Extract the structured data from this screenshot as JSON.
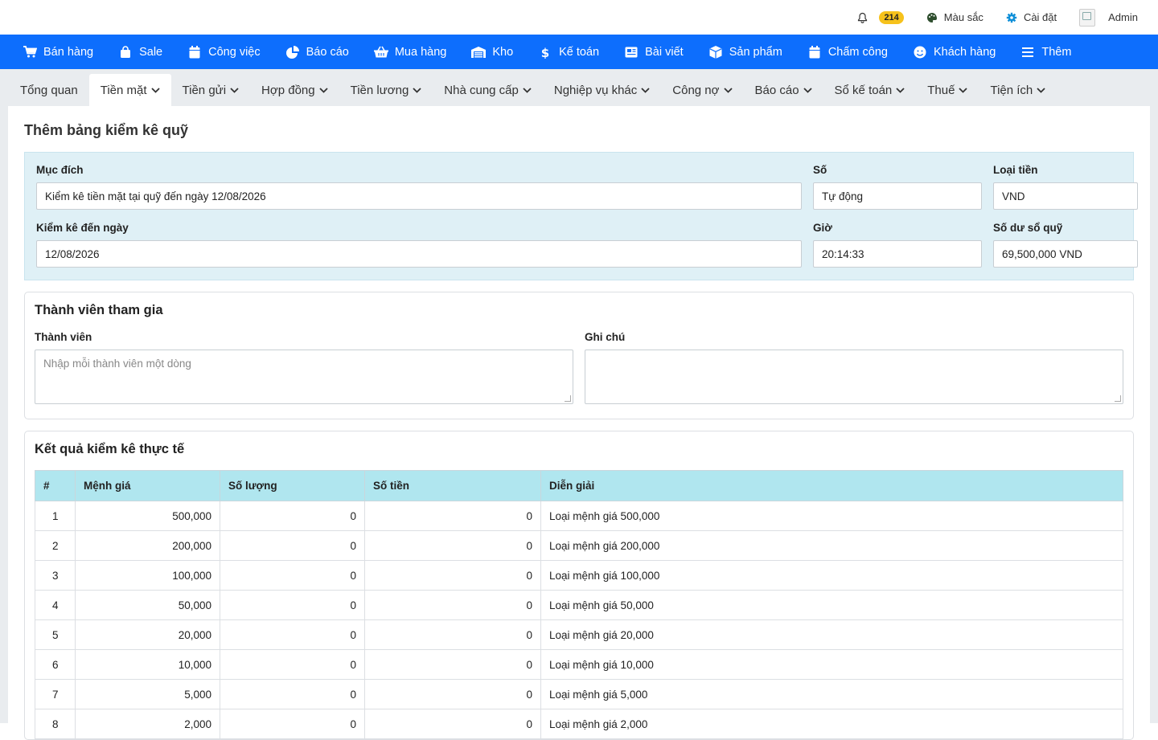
{
  "topbar": {
    "notification_count": "214",
    "color_label": "Màu sắc",
    "settings_label": "Cài đặt",
    "user_label": "Admin"
  },
  "mainnav": [
    {
      "label": "Bán hàng",
      "icon": "cart-icon"
    },
    {
      "label": "Sale",
      "icon": "bag-icon"
    },
    {
      "label": "Công việc",
      "icon": "calendar-icon"
    },
    {
      "label": "Báo cáo",
      "icon": "pie-chart-icon"
    },
    {
      "label": "Mua hàng",
      "icon": "basket-icon"
    },
    {
      "label": "Kho",
      "icon": "warehouse-icon"
    },
    {
      "label": "Kế toán",
      "icon": "dollar-icon"
    },
    {
      "label": "Bài viết",
      "icon": "newspaper-icon"
    },
    {
      "label": "Sản phẩm",
      "icon": "box-icon"
    },
    {
      "label": "Chấm công",
      "icon": "calendar-check-icon"
    },
    {
      "label": "Khách hàng",
      "icon": "smile-icon"
    },
    {
      "label": "Thêm",
      "icon": "menu-icon"
    }
  ],
  "subnav": [
    {
      "label": "Tổng quan",
      "dropdown": false
    },
    {
      "label": "Tiền mặt",
      "dropdown": true,
      "active": true
    },
    {
      "label": "Tiền gửi",
      "dropdown": true
    },
    {
      "label": "Hợp đồng",
      "dropdown": true
    },
    {
      "label": "Tiền lương",
      "dropdown": true
    },
    {
      "label": "Nhà cung cấp",
      "dropdown": true
    },
    {
      "label": "Nghiệp vụ khác",
      "dropdown": true
    },
    {
      "label": "Công nợ",
      "dropdown": true
    },
    {
      "label": "Báo cáo",
      "dropdown": true
    },
    {
      "label": "Sổ kế toán",
      "dropdown": true
    },
    {
      "label": "Thuế",
      "dropdown": true
    },
    {
      "label": "Tiện ích",
      "dropdown": true
    }
  ],
  "page": {
    "title": "Thêm bảng kiểm kê quỹ"
  },
  "form": {
    "purpose_label": "Mục đích",
    "purpose_value": "Kiểm kê tiền mặt tại quỹ đến ngày 12/08/2026",
    "number_label": "Số",
    "number_value": "Tự động",
    "currency_label": "Loại tiền",
    "currency_value": "VND",
    "date_label": "Kiểm kê đến ngày",
    "date_value": "12/08/2026",
    "time_label": "Giờ",
    "time_value": "20:14:33",
    "balance_label": "Số dư sổ quỹ",
    "balance_value": "69,500,000 VND"
  },
  "members": {
    "title": "Thành viên tham gia",
    "member_label": "Thành viên",
    "member_placeholder": "Nhập mỗi thành viên một dòng",
    "note_label": "Ghi chú",
    "note_value": ""
  },
  "results": {
    "title": "Kết quả kiểm kê thực tế",
    "columns": [
      "#",
      "Mệnh giá",
      "Số lượng",
      "Số tiền",
      "Diễn giải"
    ],
    "rows": [
      [
        "1",
        "500,000",
        "0",
        "0",
        "Loại mệnh giá 500,000"
      ],
      [
        "2",
        "200,000",
        "0",
        "0",
        "Loại mệnh giá 200,000"
      ],
      [
        "3",
        "100,000",
        "0",
        "0",
        "Loại mệnh giá 100,000"
      ],
      [
        "4",
        "50,000",
        "0",
        "0",
        "Loại mệnh giá 50,000"
      ],
      [
        "5",
        "20,000",
        "0",
        "0",
        "Loại mệnh giá 20,000"
      ],
      [
        "6",
        "10,000",
        "0",
        "0",
        "Loại mệnh giá 10,000"
      ],
      [
        "7",
        "5,000",
        "0",
        "0",
        "Loại mệnh giá 5,000"
      ],
      [
        "8",
        "2,000",
        "0",
        "0",
        "Loại mệnh giá 2,000"
      ]
    ]
  },
  "colors": {
    "nav_blue": "#0d6efd",
    "subnav_bg": "#e9ecef",
    "info_bg": "#dff0f6",
    "table_header": "#b0e6ef",
    "badge": "#f6c21c"
  }
}
